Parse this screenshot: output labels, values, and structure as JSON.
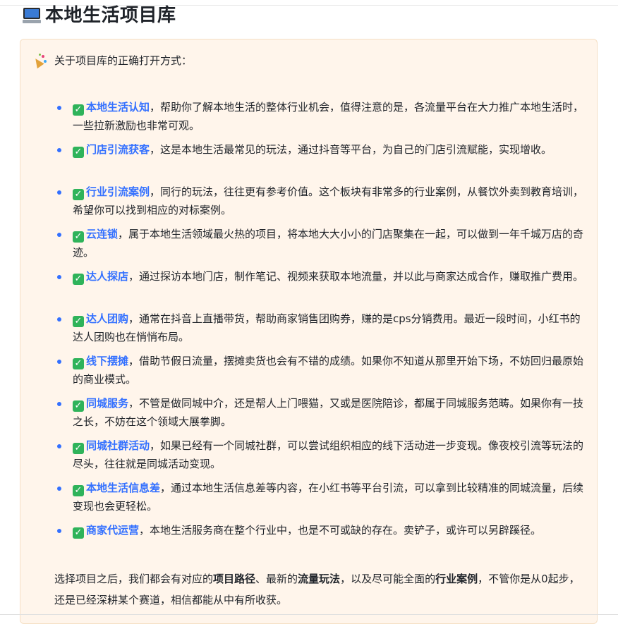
{
  "page_title": "本地生活项目库",
  "callout": {
    "intro": "关于项目库的正确打开方式：",
    "items": [
      {
        "title": "本地生活认知",
        "desc": "，帮助你了解本地生活的整体行业机会，值得注意的是，各流量平台在大力推广本地生活时，一些拉新激励也非常可观。"
      },
      {
        "title": "门店引流获客",
        "desc": "，这是本地生活最常见的玩法，通过抖音等平台，为自己的门店引流赋能，实现增收。"
      },
      {
        "title": "行业引流案例",
        "desc": "，同行的玩法，往往更有参考价值。这个板块有非常多的行业案例，从餐饮外卖到教育培训，希望你可以找到相应的对标案例。"
      },
      {
        "title": "云连锁",
        "desc": "，属于本地生活领域最火热的项目，将本地大大小小的门店聚集在一起，可以做到一年千城万店的奇迹。"
      },
      {
        "title": "达人探店",
        "desc": "，通过探访本地门店，制作笔记、视频来获取本地流量，并以此与商家达成合作，赚取推广费用。"
      },
      {
        "title": "达人团购",
        "desc": "，通常在抖音上直播带货，帮助商家销售团购券，赚的是cps分销费用。最近一段时间，小红书的达人团购也在悄悄布局。"
      },
      {
        "title": "线下摆摊",
        "desc": "，借助节假日流量，摆摊卖货也会有不错的成绩。如果你不知道从那里开始下场，不妨回归最原始的商业模式。"
      },
      {
        "title": "同城服务",
        "desc": "，不管是做同城中介，还是帮人上门喂猫，又或是医院陪诊，都属于同城服务范畴。如果你有一技之长，不妨在这个领域大展拳脚。"
      },
      {
        "title": "同城社群活动",
        "desc": "，如果已经有一个同城社群，可以尝试组织相应的线下活动进一步变现。像夜校引流等玩法的尽头，往往就是同城活动变现。"
      },
      {
        "title": "本地生活信息差",
        "desc": "，通过本地生活信息差等内容，在小红书等平台引流，可以拿到比较精准的同城流量，后续变现也会更轻松。"
      },
      {
        "title": "商家代运营",
        "desc": "，本地生活服务商在整个行业中，也是不可或缺的存在。卖铲子，或许可以另辟蹊径。"
      }
    ],
    "check_glyph": "✓",
    "conclusion": {
      "p1": "选择项目之后，我们都会有对应的",
      "b1": "项目路径",
      "p2": "、最新的",
      "b2": "流量玩法",
      "p3": "，以及尽可能全面的",
      "b3": "行业案例",
      "p4": "，不管你是从0起步，还是已经深耕某个赛道，相信都能从中有所收获。"
    }
  },
  "colors": {
    "accent": "#3370ff",
    "check": "#2fb35a",
    "callout_bg": "#fff5eb",
    "callout_border": "#f5dfc4"
  },
  "icons": {
    "title": "laptop-icon",
    "intro": "party-popper-icon",
    "item": "check-mark-icon"
  }
}
